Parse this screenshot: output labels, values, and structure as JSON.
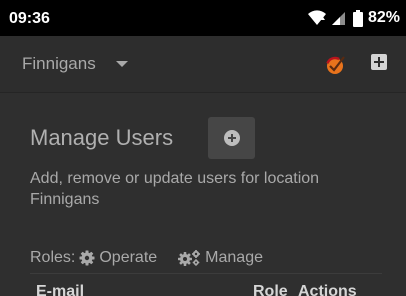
{
  "status_bar": {
    "time": "09:36",
    "battery": "82%",
    "icons": [
      "wifi-icon",
      "signal-icon",
      "battery-icon"
    ]
  },
  "app_bar": {
    "location_selected": "Finnigans",
    "icons": [
      "dropdown-caret-icon",
      "brand-logo-icon",
      "add-square-icon"
    ]
  },
  "main": {
    "title": "Manage Users",
    "description": "Add, remove or update users for location Finnigans",
    "roles": {
      "label": "Roles:",
      "operate": "Operate",
      "manage": "Manage"
    },
    "table": {
      "columns": [
        "E-mail",
        "Role",
        "Actions"
      ]
    }
  },
  "colors": {
    "background": "#2f2f2f",
    "status_bar": "#000000",
    "button_bg": "#464646",
    "text": "#a9a9a9",
    "logo_accent": "#e8731c"
  }
}
